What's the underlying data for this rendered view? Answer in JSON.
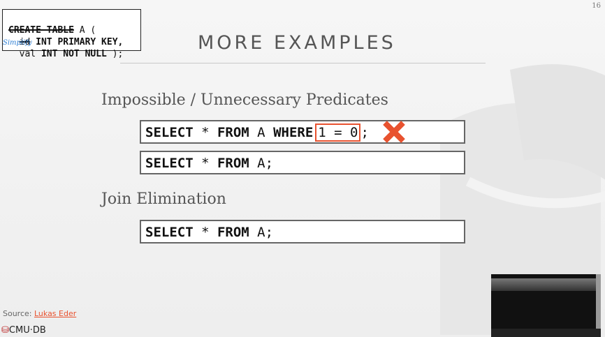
{
  "page_number": "16",
  "schema": {
    "line1_kw": "CREATE TABLE",
    "line1_rest": " A (",
    "line2_col": "id",
    "line2_def": " INT PRIMARY KEY,",
    "line3_col": "val",
    "line3_def": " INT NOT NULL",
    "line3_end": " );",
    "annotation": "Simplify"
  },
  "title": "MORE EXAMPLES",
  "section1": {
    "heading": "Impossible / Unnecessary Predicates",
    "query1": {
      "select": "SELECT",
      "star": " * ",
      "from": "FROM",
      "table": " A ",
      "where": "WHERE",
      "predicate": "1 = 0",
      "end": ";"
    },
    "query2": {
      "select": "SELECT",
      "star": " * ",
      "from": "FROM",
      "table": " A;"
    }
  },
  "section2": {
    "heading": "Join Elimination",
    "query": {
      "select": "SELECT",
      "star": " * ",
      "from": "FROM",
      "table": " A;"
    }
  },
  "footer": {
    "source_label": "Source: ",
    "source_link": "Lukas Eder",
    "logo": "CMU·DB"
  },
  "colors": {
    "accent": "#e8522f",
    "annotation": "#2e7fd4",
    "title": "#555555"
  }
}
